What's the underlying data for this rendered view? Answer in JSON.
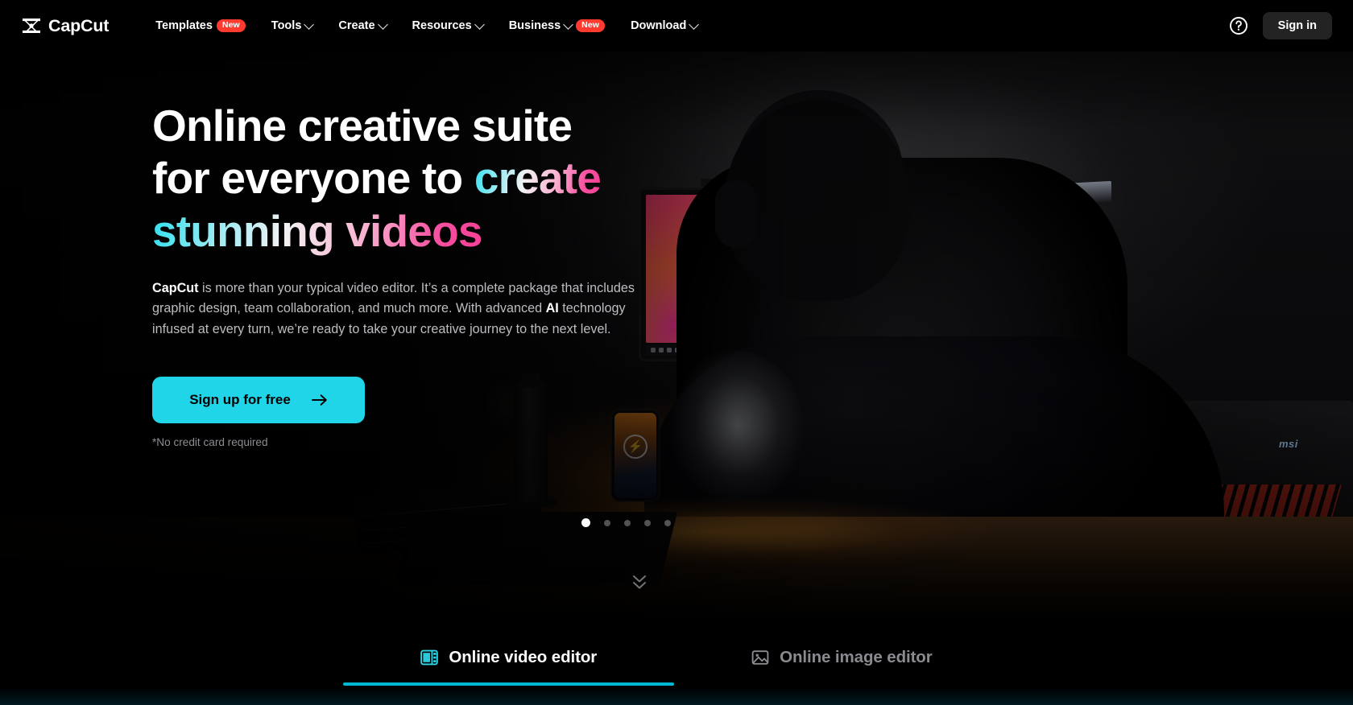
{
  "nav": {
    "brand": "CapCut",
    "brand_icon": "capcut-logo-icon",
    "items": [
      {
        "label": "Templates",
        "badge": "New",
        "caret": false
      },
      {
        "label": "Tools",
        "badge": null,
        "caret": true
      },
      {
        "label": "Create",
        "badge": null,
        "caret": true
      },
      {
        "label": "Resources",
        "badge": null,
        "caret": true
      },
      {
        "label": "Business",
        "badge": "New",
        "caret": true
      },
      {
        "label": "Download",
        "badge": null,
        "caret": true
      }
    ],
    "help_icon": "help-circle-icon",
    "sign_in": "Sign in"
  },
  "hero": {
    "headline_line1": "Online creative suite",
    "headline_line2_plain": "for everyone to ",
    "headline_line2_grad": "create",
    "headline_line3_grad": "stunning videos",
    "body_bold_1": "CapCut",
    "body_text_1": " is more than your typical video editor. It’s a complete package that includes graphic design, team collaboration, and much more. With advanced ",
    "body_bold_2": "AI",
    "body_text_2": " technology infused at every turn, we’re ready to take your creative journey to the next level.",
    "cta_label": "Sign up for free",
    "cta_icon": "arrow-right-icon",
    "disclaimer": "*No credit card required",
    "scroll_icon": "double-chevron-down-icon",
    "carousel": {
      "total": 5,
      "active_index": 0
    }
  },
  "tabs": [
    {
      "label": "Online video editor",
      "icon": "film-strip-icon",
      "active": true
    },
    {
      "label": "Online image editor",
      "icon": "image-icon",
      "active": false
    }
  ],
  "colors": {
    "accent_cyan": "#20D5E8",
    "tab_underline": "#00B8D4",
    "badge_red": "#FF3B30",
    "headline_grad_start": "#2fe0ee",
    "headline_grad_end": "#f53f96",
    "page_bg": "#000000",
    "signin_bg": "#232323"
  }
}
